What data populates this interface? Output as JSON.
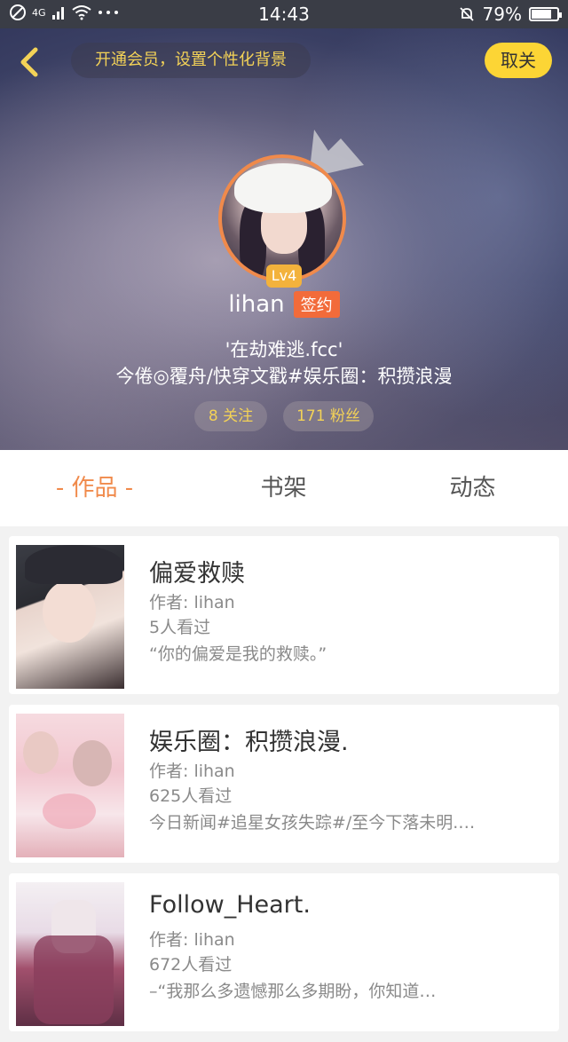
{
  "status_bar": {
    "network": "4G",
    "time": "14:43",
    "battery": "79%",
    "battery_fraction": 0.79
  },
  "header": {
    "vip_prompt": "开通会员，设置个性化背景",
    "follow_button": "取关",
    "level": "Lv4",
    "username": "lihan",
    "sign_badge": "签约",
    "signature_line1": "'在劫难逃.fcc'",
    "signature_line2": "今倦◎覆舟/快穿文戳#娱乐圈：积攒浪漫",
    "following": "8 关注",
    "followers": "171 粉丝"
  },
  "tabs": [
    {
      "label": "- 作品 -"
    },
    {
      "label": "书架"
    },
    {
      "label": "动态"
    }
  ],
  "works": [
    {
      "title": "偏爱救赎",
      "author": "作者: lihan",
      "views": "5人看过",
      "desc": "“你的偏爱是我的救赎。”"
    },
    {
      "title": "娱乐圈：积攒浪漫.",
      "author": "作者: lihan",
      "views": "625人看过",
      "desc": "今日新闻#追星女孩失踪#/至今下落未明.…"
    },
    {
      "title": "Follow_Heart.",
      "author": "作者: lihan",
      "views": "672人看过",
      "desc": "–“我那么多遗憾那么多期盼，你知道…"
    }
  ],
  "colors": {
    "accent": "#f08a4b",
    "follow_button": "#fcd535",
    "gold_text": "#f3d257",
    "sign_badge": "#f26b3a"
  }
}
